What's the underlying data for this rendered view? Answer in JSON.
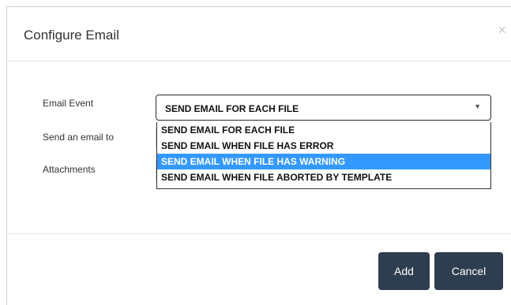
{
  "dialog": {
    "title": "Configure Email",
    "close_label": "×"
  },
  "form": {
    "email_event_label": "Email Event",
    "send_to_label": "Send an email to",
    "attachments_label": "Attachments",
    "email_event_selected": "SEND EMAIL FOR EACH FILE",
    "dropdown_arrow": "▼",
    "email_event_options": [
      {
        "label": "SEND EMAIL FOR EACH FILE",
        "highlighted": false
      },
      {
        "label": "SEND EMAIL WHEN FILE HAS ERROR",
        "highlighted": false
      },
      {
        "label": "SEND EMAIL WHEN FILE HAS WARNING",
        "highlighted": true
      },
      {
        "label": "SEND EMAIL WHEN FILE ABORTED BY TEMPLATE",
        "highlighted": false
      }
    ]
  },
  "footer": {
    "add_label": "Add",
    "cancel_label": "Cancel"
  },
  "colors": {
    "button_bg": "#2f3e4e",
    "highlight": "#3399ff"
  }
}
